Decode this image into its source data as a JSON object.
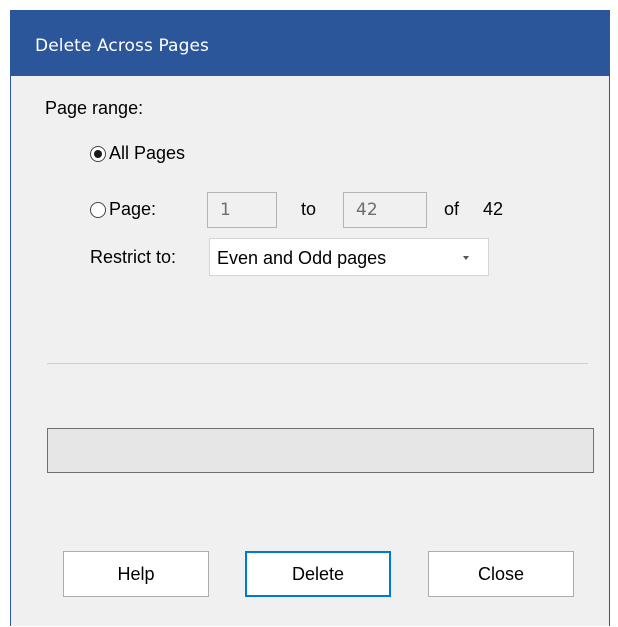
{
  "window": {
    "title": "Delete Across Pages",
    "colors": {
      "titlebar": "#2b579a",
      "background": "#f0f0f0",
      "default_button_border": "#0078d7"
    }
  },
  "page_range": {
    "label": "Page range:",
    "all_pages": {
      "label": "All Pages",
      "selected": true
    },
    "page": {
      "label": "Page:",
      "from_value": "1",
      "to_label": "to",
      "to_value": "42",
      "of_label": "of",
      "total": "42",
      "selected": false
    }
  },
  "restrict": {
    "label": "Restrict to:",
    "selected": "Even and Odd pages",
    "arrow_icon": "dropdown-arrow-icon"
  },
  "progress": {
    "value": 0
  },
  "buttons": {
    "help": "Help",
    "delete": "Delete",
    "close": "Close"
  }
}
